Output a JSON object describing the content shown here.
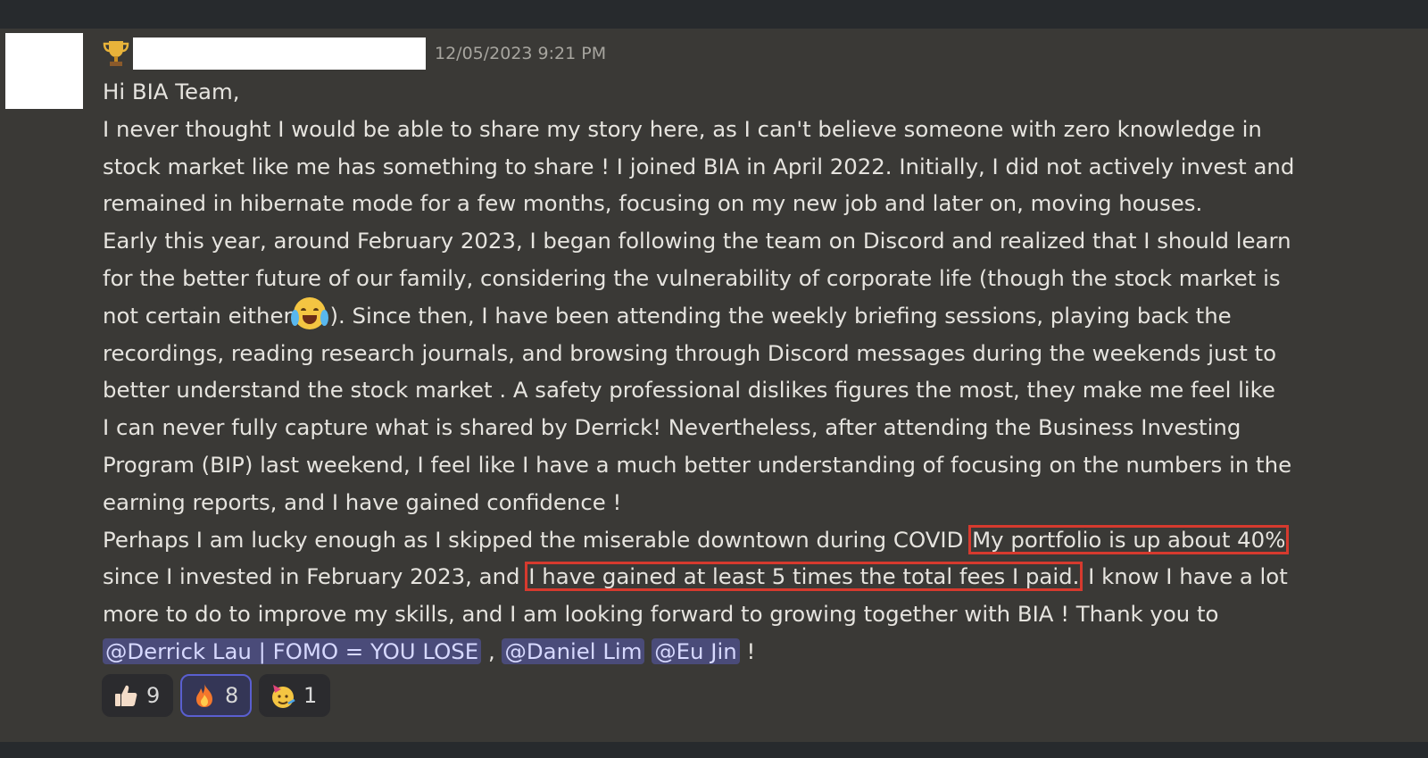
{
  "message": {
    "timestamp": "12/05/2023 9:21 PM",
    "lines": [
      "Hi BIA Team,",
      "I never thought I would be able to share my story here, as I can't believe someone with zero knowledge in",
      "stock market like me has something to share ! I joined BIA in April 2022. Initially, I did not actively invest and",
      "remained in hibernate mode for a few months, focusing on my new job and later on, moving houses.",
      "Early this year, around February 2023, I began following the team on Discord and realized that I should learn",
      "for the better future of our family, considering the vulnerability of corporate life (though the stock market is"
    ],
    "line7_a": "not certain either",
    "line7_b": "). Since then, I have been attending the weekly briefing sessions, playing back the",
    "lines2": [
      "recordings, reading research journals, and browsing through Discord messages during the weekends just to",
      "better understand the stock market . A safety professional dislikes figures the most,  they make me feel like",
      "I can never fully capture what is shared by Derrick! Nevertheless, after attending the Business Investing",
      "Program (BIP) last weekend, I feel like I have a much better understanding of focusing on the numbers in the",
      "earning reports, and I have gained confidence !"
    ],
    "line13_a": "Perhaps I am lucky enough as I skipped the miserable downtown during COVID",
    "line13_hl": "My portfolio is up about 40%",
    "line14_a": "since I invested in February 2023, and",
    "line14_hl": "I have gained at least 5 times the total fees I paid.",
    "line14_b": "I know I have a lot",
    "line15": "more to do to improve my skills, and I am looking forward to growing together with BIA !  Thank you to",
    "mentions": [
      "@Derrick Lau | FOMO = YOU LOSE",
      "@Daniel Lim",
      "@Eu Jin"
    ],
    "sep1": " , ",
    "sep2": " ",
    "end": "  !"
  },
  "reactions": [
    {
      "emoji": "thumbs-up",
      "count": "9"
    },
    {
      "emoji": "fire",
      "count": "8"
    },
    {
      "emoji": "partying-face",
      "count": "1"
    }
  ],
  "colors": {
    "highlight_box": "#d63a2e",
    "mention_bg": "#4a4b79",
    "background": "#3a3936"
  }
}
